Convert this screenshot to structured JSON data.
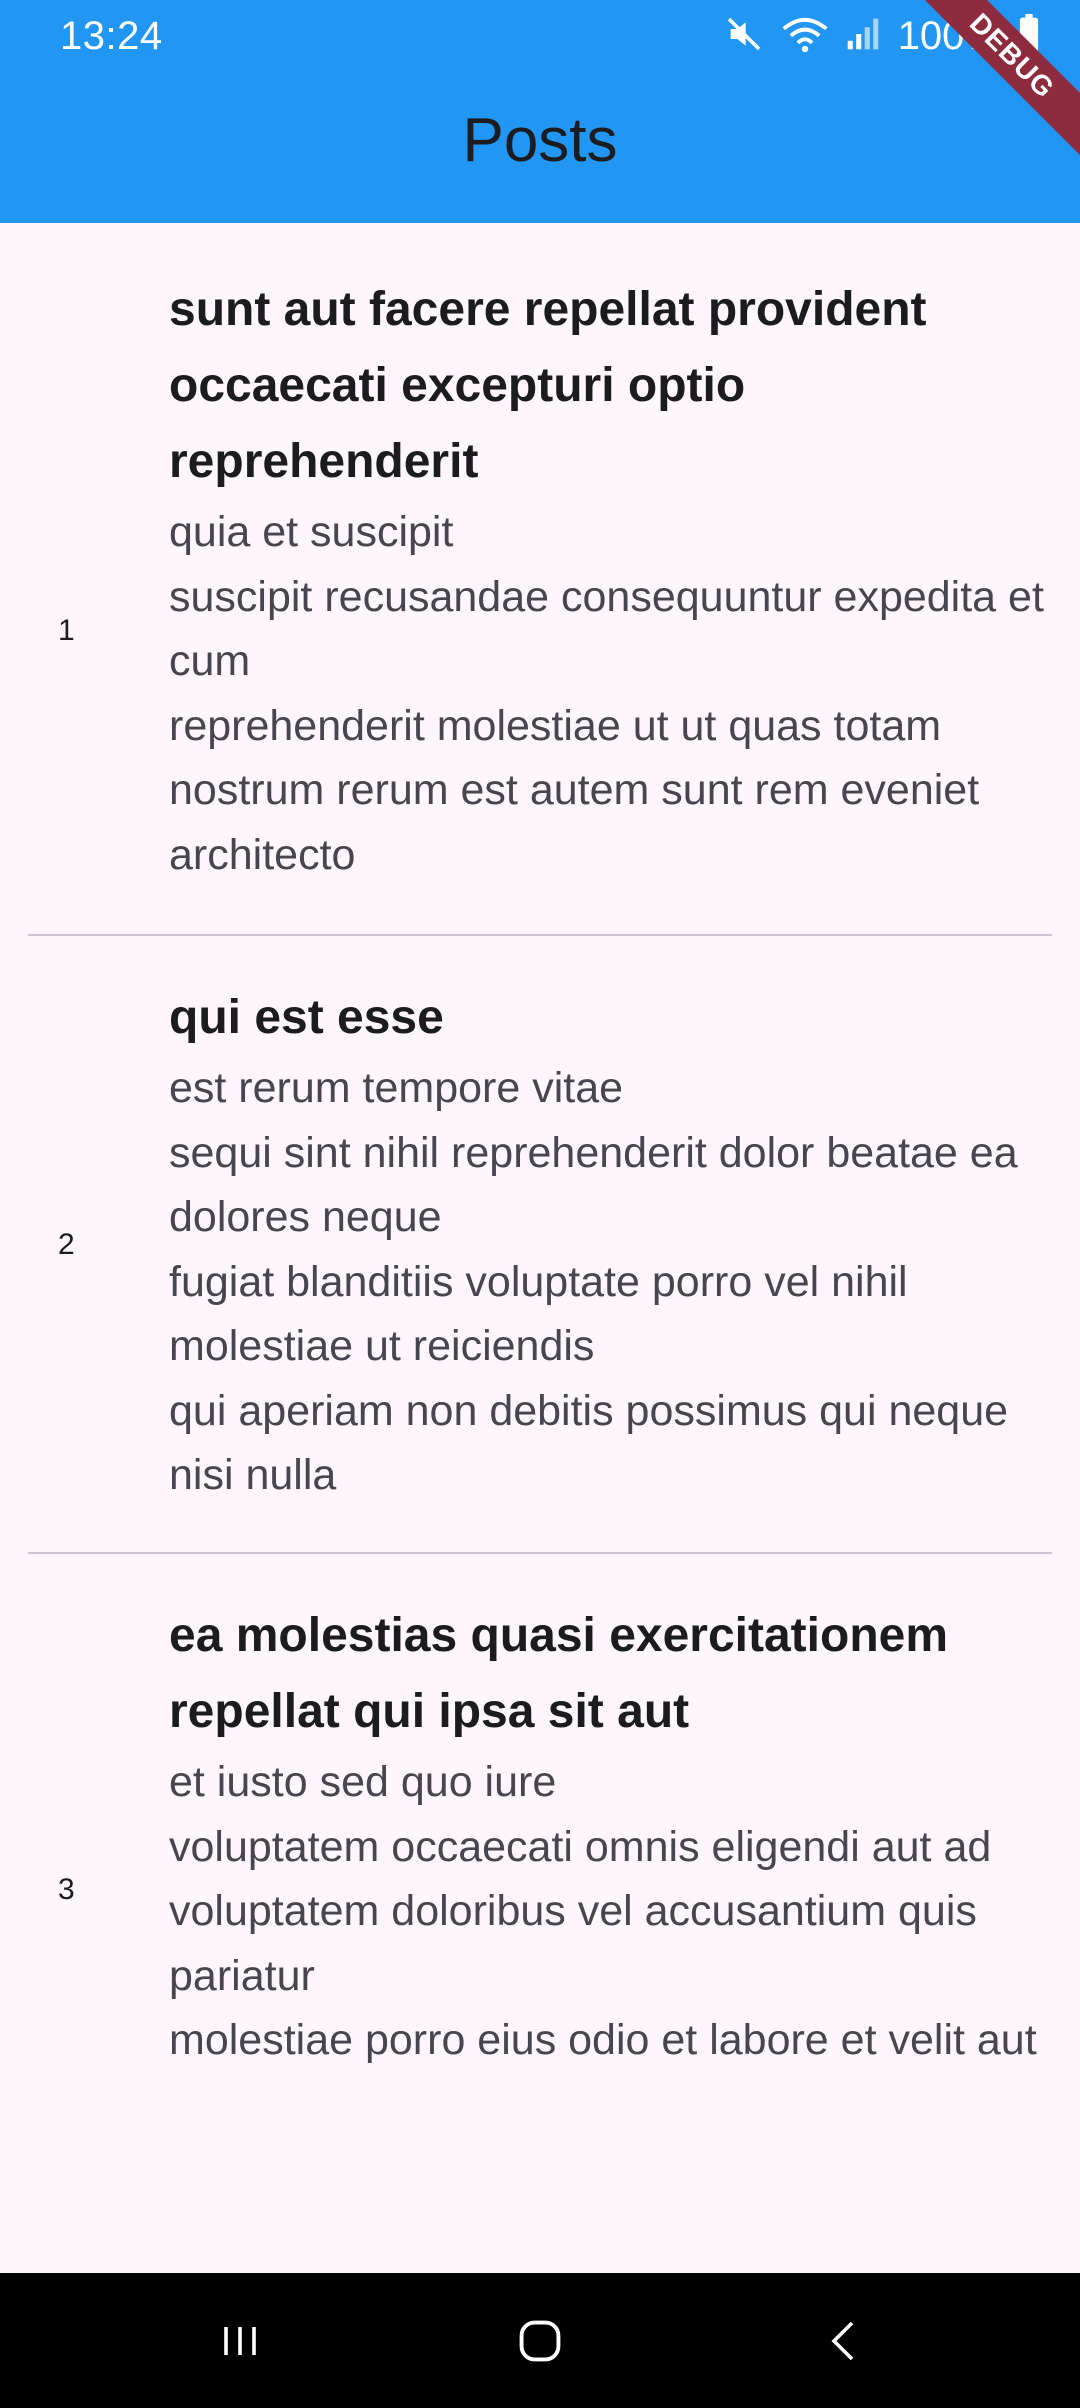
{
  "status_bar": {
    "time": "13:24",
    "battery_percent": "100%",
    "icons": [
      "mute-icon",
      "wifi-icon",
      "signal-icon",
      "battery-icon"
    ]
  },
  "debug_banner": "DEBUG",
  "app_bar": {
    "title": "Posts",
    "color": "#2196f3"
  },
  "posts": [
    {
      "id": "1",
      "title": "sunt aut facere repellat provident occaecati excepturi optio reprehenderit",
      "body": "quia et suscipit\nsuscipit recusandae consequuntur expedita et cum\nreprehenderit molestiae ut ut quas totam\nnostrum rerum est autem sunt rem eveniet architecto"
    },
    {
      "id": "2",
      "title": "qui est esse",
      "body": "est rerum tempore vitae\nsequi sint nihil reprehenderit dolor beatae ea dolores neque\nfugiat blanditiis voluptate porro vel nihil molestiae ut reiciendis\nqui aperiam non debitis possimus qui neque nisi nulla"
    },
    {
      "id": "3",
      "title": "ea molestias quasi exercitationem repellat qui ipsa sit aut",
      "body": "et iusto sed quo iure\nvoluptatem occaecati omnis eligendi aut ad\nvoluptatem doloribus vel accusantium quis pariatur\nmolestiae porro eius odio et labore et velit aut"
    }
  ],
  "nav_bar": {
    "buttons": [
      "recent-apps-icon",
      "home-icon",
      "back-icon"
    ]
  }
}
